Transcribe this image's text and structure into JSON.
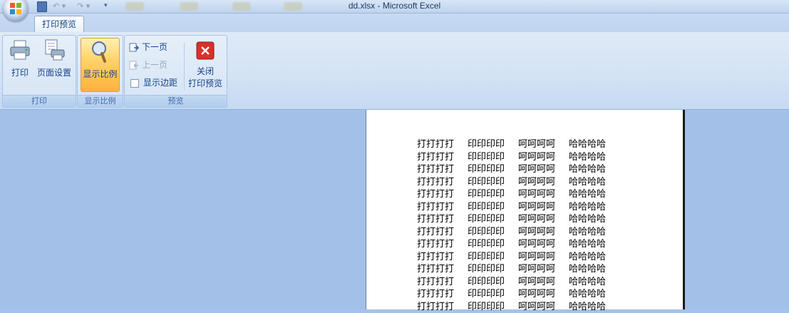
{
  "window": {
    "title": "dd.xlsx - Microsoft Excel"
  },
  "quick_access": {
    "icons": [
      "save-icon",
      "undo-icon",
      "redo-icon",
      "customize-icon"
    ]
  },
  "tabs": [
    {
      "label": "打印预览",
      "active": true
    }
  ],
  "ribbon": {
    "groups": {
      "print": {
        "label": "打印",
        "print_button": "打印",
        "page_setup_button": "页面设置"
      },
      "zoom": {
        "label": "显示比例",
        "zoom_button": "显示比例"
      },
      "preview": {
        "label": "预览",
        "next_page": "下一页",
        "prev_page": "上一页",
        "show_margins": "显示边距",
        "close_line1": "关闭",
        "close_line2": "打印预览"
      }
    }
  },
  "sheet": {
    "columns": [
      "打打打打",
      "印印印印",
      "呵呵呵呵",
      "哈哈哈哈"
    ],
    "rows": [
      [
        "打打打打",
        "印印印印",
        "呵呵呵呵",
        "哈哈哈哈"
      ],
      [
        "打打打打",
        "印印印印",
        "呵呵呵呵",
        "哈哈哈哈"
      ],
      [
        "打打打打",
        "印印印印",
        "呵呵呵呵",
        "哈哈哈哈"
      ],
      [
        "打打打打",
        "印印印印",
        "呵呵呵呵",
        "哈哈哈哈"
      ],
      [
        "打打打打",
        "印印印印",
        "呵呵呵呵",
        "哈哈哈哈"
      ],
      [
        "打打打打",
        "印印印印",
        "呵呵呵呵",
        "哈哈哈哈"
      ],
      [
        "打打打打",
        "印印印印",
        "呵呵呵呵",
        "哈哈哈哈"
      ],
      [
        "打打打打",
        "印印印印",
        "呵呵呵呵",
        "哈哈哈哈"
      ],
      [
        "打打打打",
        "印印印印",
        "呵呵呵呵",
        "哈哈哈哈"
      ],
      [
        "打打打打",
        "印印印印",
        "呵呵呵呵",
        "哈哈哈哈"
      ],
      [
        "打打打打",
        "印印印印",
        "呵呵呵呵",
        "哈哈哈哈"
      ],
      [
        "打打打打",
        "印印印印",
        "呵呵呵呵",
        "哈哈哈哈"
      ],
      [
        "打打打打",
        "印印印印",
        "呵呵呵呵",
        "哈哈哈哈"
      ],
      [
        "打打打打",
        "印印印印",
        "呵呵呵呵",
        "哈哈哈哈"
      ]
    ]
  },
  "colors": {
    "ribbon_text": "#15428b",
    "workspace_bg": "#a3c1e8",
    "active_button": "#ffc75a",
    "close_icon": "#d8312b"
  }
}
